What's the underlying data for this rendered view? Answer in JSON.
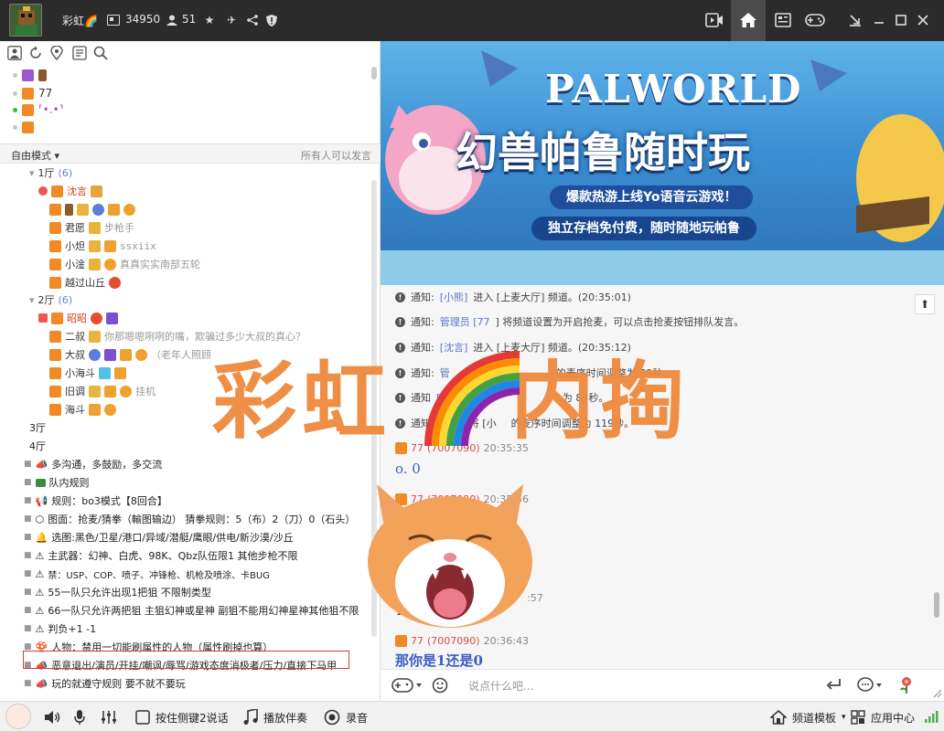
{
  "topbar": {
    "nickname": "彩虹🌈",
    "user_id": "34950",
    "online_count": "51"
  },
  "left": {
    "mode_label": "自由模式",
    "speak_policy": "所有人可以发言",
    "top_users": [
      {
        "name": ""
      },
      {
        "name": "77"
      },
      {
        "name": "⸢•.•⸣"
      },
      {
        "name": ""
      }
    ],
    "hall1": {
      "name": "1厅",
      "count": "(6)"
    },
    "hall1_members": [
      {
        "name": "沈言",
        "note": ""
      },
      {
        "name": "",
        "note": ""
      },
      {
        "name": "君愿",
        "note": "步枪手"
      },
      {
        "name": "小炟",
        "note": "ssxiix"
      },
      {
        "name": "小淦",
        "note": "真真实实南部五轮"
      },
      {
        "name": "越过山丘",
        "note": ""
      }
    ],
    "hall2": {
      "name": "2厅",
      "count": "(6)"
    },
    "hall2_members": [
      {
        "name": "昭昭",
        "note": ""
      },
      {
        "name": "二叔",
        "note": "你那嗯嗯咧咧的嘴，欺骗过多少大叔的真心？"
      },
      {
        "name": "大叔",
        "note": "（老年人照顾"
      },
      {
        "name": "小海斗",
        "note": ""
      },
      {
        "name": "旧调",
        "note": "挂机"
      },
      {
        "name": "海斗",
        "note": ""
      }
    ],
    "channels": [
      "3厅",
      "4厅",
      "多沟通，多鼓励，多交流",
      "队内规则",
      "规则：bo3模式【8回合】",
      "图面：抢麦/猜拳（輸图输边）  猜拳规则：5（布）2（刀）0（石头）",
      "选图:黑色/卫星/港口/异域/潜艇/鹰眼/供电/新沙漠/沙丘",
      "主武器：幻神、白虎、98K、Qbz队伍限1  其他步枪不限",
      "禁：USP、COP、喷子、冲锋枪、机枪及喷涂、卡BUG",
      "55一队只允许出现1把狙   不限制类型",
      "66一队只允许两把狙  主狙幻神或星神  副狙不能用幻神星神其他狙不限",
      "判负+1 -1",
      "人物：禁用一切能刷属性的人物（属性刷掉也算）",
      "恶意退出/演员/开挂/嘲讽/辱骂/游戏态度消极者/压力/直接下马甲",
      "玩的就遵守规则  要不就不要玩"
    ]
  },
  "banner": {
    "title_en": "PALWORLD",
    "title_cn": "幻兽帕鲁随时玩",
    "line1": "爆款热游上线Yo语音云游戏！",
    "line2": "独立存档免付费，随时随地玩帕鲁"
  },
  "chat": {
    "notices": [
      {
        "label": "通知:",
        "user": "[小熊]",
        "text": "进入 [上麦大厅] 频道。(20:35:01)"
      },
      {
        "label": "通知:",
        "user": "管理员 [77",
        "text": "] 将频道设置为开启抢麦，可以点击抢麦按钮排队发言。"
      },
      {
        "label": "通知:",
        "user": "[沈言]",
        "text": "进入 [上麦大厅] 频道。(20:35:12)"
      },
      {
        "label": "通知:",
        "user": "管",
        "text": "的麦序时间调整为 59秒。"
      },
      {
        "label": "通知",
        "user": "[77",
        "text": "] 将 [小",
        "tail": "为 89秒。"
      },
      {
        "label": "通知:",
        "user": "[77",
        "text": "] 将 [小",
        "tail": "的麦序时间调整为 119秒。"
      }
    ],
    "messages": [
      {
        "user": "77",
        "uid": "(7007090)",
        "time": "20:35:35",
        "text": "o. 0"
      },
      {
        "user": "77",
        "uid": "(7007090)",
        "time": "20:35:56",
        "text": ""
      },
      {
        "user": "",
        "uid": "",
        "time": ":57",
        "text": "16"
      },
      {
        "user": "77",
        "uid": "(7007090)",
        "time": "20:36:43",
        "text": "那你是1还是0"
      }
    ],
    "input_placeholder": "说点什么吧..."
  },
  "bottombar": {
    "ptt_label": "按住侧键2说话",
    "music_label": "播放伴奏",
    "record_label": "录音",
    "template_label": "频道模板",
    "app_center_label": "应用中心"
  },
  "overlay": {
    "caption_left": "彩虹",
    "caption_right": "内掏"
  }
}
